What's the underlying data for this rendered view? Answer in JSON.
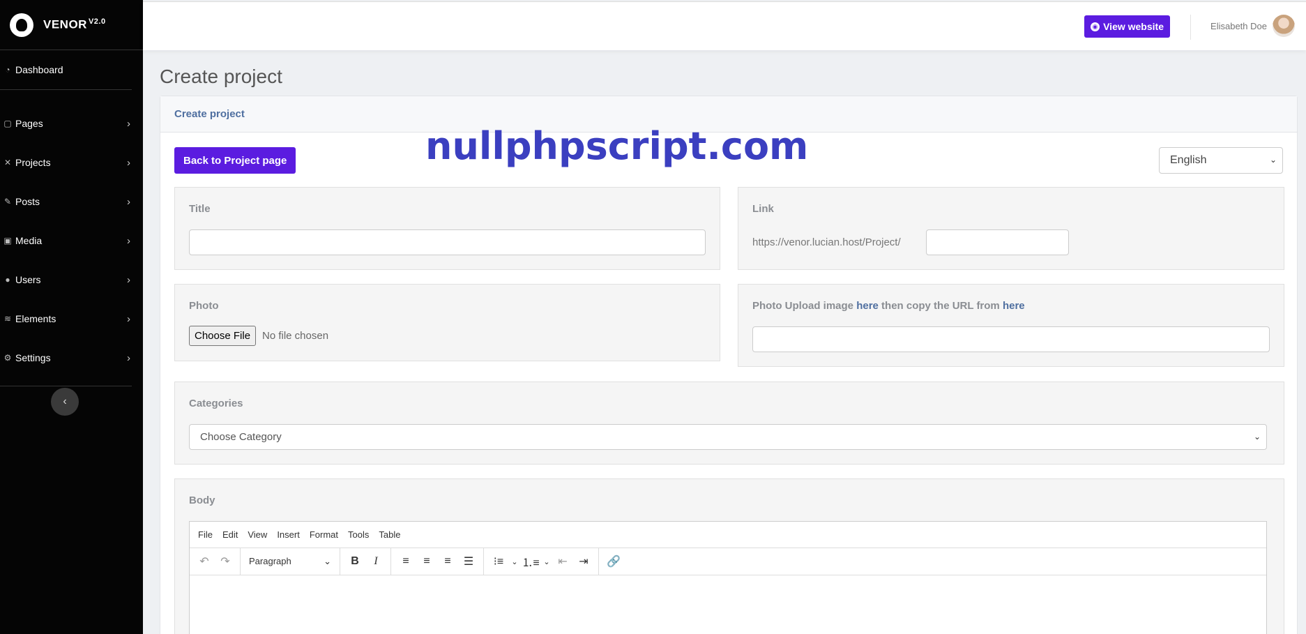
{
  "brand": {
    "name": "VENOR",
    "version": "V2.0"
  },
  "sidebar": {
    "dashboard": {
      "label": "Dashboard",
      "icon": "dashboard-icon"
    },
    "items": [
      {
        "label": "Pages",
        "icon": "file-icon"
      },
      {
        "label": "Projects",
        "icon": "tools-icon"
      },
      {
        "label": "Posts",
        "icon": "edit-icon"
      },
      {
        "label": "Media",
        "icon": "image-icon"
      },
      {
        "label": "Users",
        "icon": "user-icon"
      },
      {
        "label": "Elements",
        "icon": "layers-icon"
      },
      {
        "label": "Settings",
        "icon": "cogs-icon"
      }
    ],
    "collapse_icon": "chevron-left-icon"
  },
  "topbar": {
    "view_website": "View website",
    "user_name": "Elisabeth Doe"
  },
  "page": {
    "title": "Create project"
  },
  "card": {
    "header": "Create project",
    "back_button": "Back to Project page",
    "language": "English",
    "watermark": "nullphpscript.com"
  },
  "form": {
    "title_label": "Title",
    "title_value": "",
    "link_label": "Link",
    "link_prefix": "https://venor.lucian.host/Project/",
    "link_value": "",
    "photo_label": "Photo",
    "file_button": "Choose File",
    "file_status": "No file chosen",
    "photo_url_label_1": "Photo Upload image ",
    "photo_url_link_1": "here",
    "photo_url_label_2": " then copy the URL from ",
    "photo_url_link_2": "here",
    "photo_url_value": "",
    "categories_label": "Categories",
    "categories_value": "Choose Category",
    "body_label": "Body"
  },
  "editor": {
    "menu": [
      "File",
      "Edit",
      "View",
      "Insert",
      "Format",
      "Tools",
      "Table"
    ],
    "block_format": "Paragraph"
  },
  "colors": {
    "accent": "#5b1ce0",
    "sidebar_bg": "#050505",
    "link": "#4f6fa0"
  }
}
